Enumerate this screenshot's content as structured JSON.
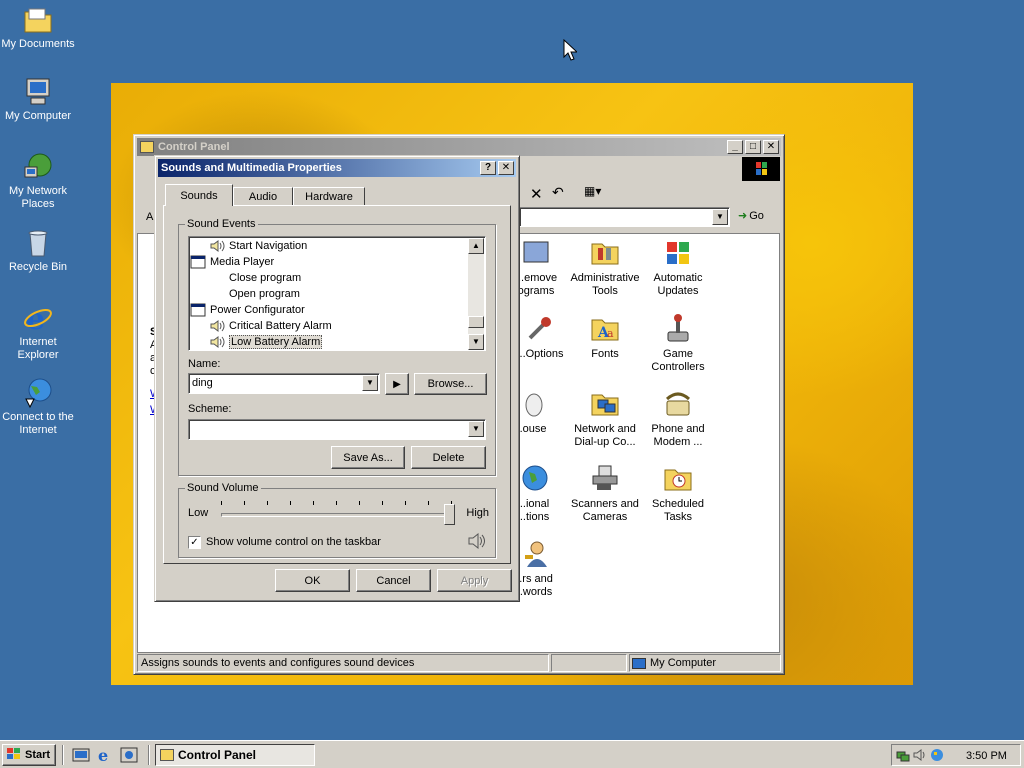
{
  "desktop": {
    "icons": [
      {
        "label": "My Documents"
      },
      {
        "label": "My Computer"
      },
      {
        "label": "My Network Places"
      },
      {
        "label": "Recycle Bin"
      },
      {
        "label": "Internet Explorer"
      },
      {
        "label": "Connect to the Internet"
      }
    ]
  },
  "control_panel": {
    "title": "Control Panel",
    "address_prefix": "A",
    "go_label": "Go",
    "icons": [
      {
        "label": "...emove\nograms"
      },
      {
        "label": "Administrative Tools"
      },
      {
        "label": "Automatic Updates"
      },
      {
        "label": "...Options"
      },
      {
        "label": "Fonts"
      },
      {
        "label": "Game Controllers"
      },
      {
        "label": "...ouse"
      },
      {
        "label": "Network and Dial-up Co..."
      },
      {
        "label": "Phone and Modem ..."
      },
      {
        "label": "...ional\n...tions"
      },
      {
        "label": "Scanners and Cameras"
      },
      {
        "label": "Scheduled Tasks"
      },
      {
        "label": "...rs and\n...words"
      }
    ],
    "left_fragments": [
      "S",
      "A",
      "a",
      "c",
      "W",
      "W"
    ],
    "status_text": "Assigns sounds to events and configures sound devices",
    "status_zone": "My Computer"
  },
  "dialog": {
    "title": "Sounds and Multimedia Properties",
    "help_btn": "?",
    "close_btn": "✕",
    "tabs": [
      {
        "label": "Sounds"
      },
      {
        "label": "Audio"
      },
      {
        "label": "Hardware"
      }
    ],
    "sound_events_label": "Sound Events",
    "events": [
      {
        "label": "Start Navigation",
        "indent": 1,
        "icon": "speaker-icon"
      },
      {
        "label": "Media Player",
        "indent": 0,
        "icon": "window-icon"
      },
      {
        "label": "Close program",
        "indent": 1,
        "icon": ""
      },
      {
        "label": "Open program",
        "indent": 1,
        "icon": ""
      },
      {
        "label": "Power Configurator",
        "indent": 0,
        "icon": "window-icon"
      },
      {
        "label": "Critical Battery Alarm",
        "indent": 1,
        "icon": "speaker-icon"
      },
      {
        "label": "Low Battery Alarm",
        "indent": 1,
        "icon": "speaker-icon",
        "selected": true
      }
    ],
    "name_label": "Name:",
    "name_value": "ding",
    "browse_label": "Browse...",
    "scheme_label": "Scheme:",
    "scheme_value": "",
    "save_as_label": "Save As...",
    "delete_label": "Delete",
    "volume_label": "Sound Volume",
    "low_label": "Low",
    "high_label": "High",
    "volume_level": 1.0,
    "show_volume_label": "Show volume control on the taskbar",
    "show_volume_checked": true,
    "ok_label": "OK",
    "cancel_label": "Cancel",
    "apply_label": "Apply"
  },
  "taskbar": {
    "start_label": "Start",
    "task_label": "Control Panel",
    "clock": "3:50 PM"
  }
}
